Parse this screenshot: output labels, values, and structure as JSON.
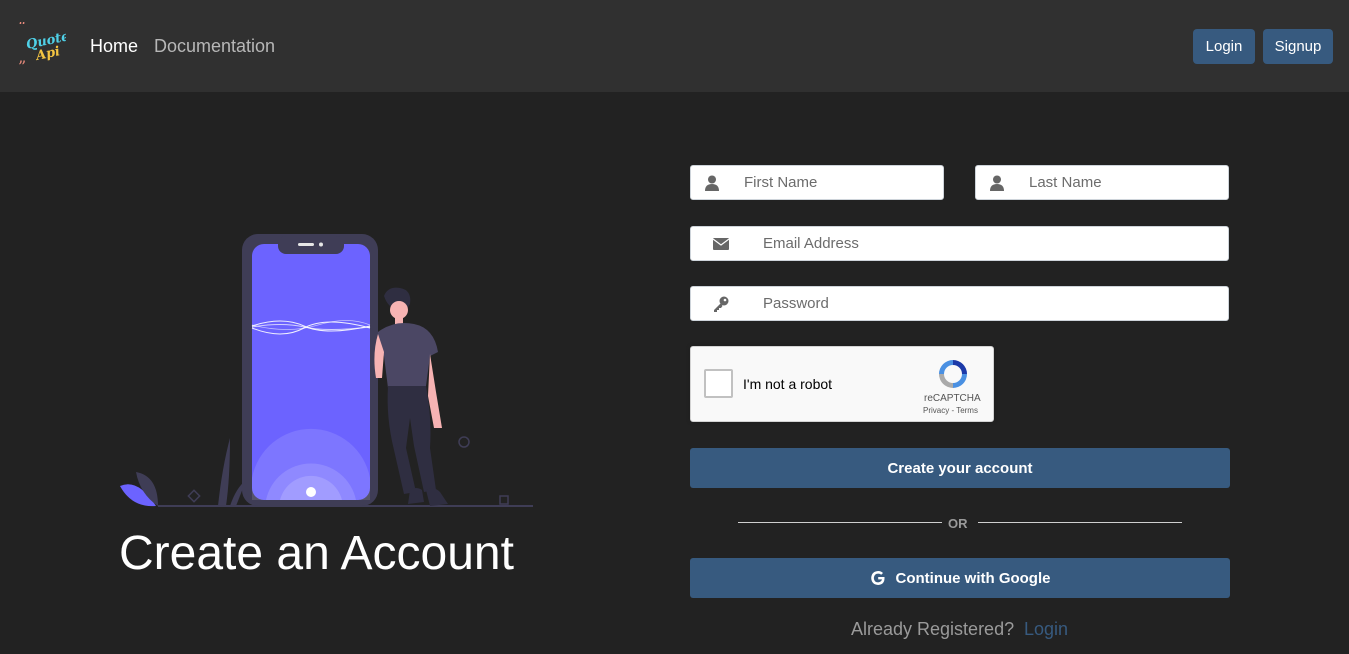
{
  "nav": {
    "logo_text": "Quotes Api",
    "home": "Home",
    "documentation": "Documentation",
    "login": "Login",
    "signup": "Signup"
  },
  "hero": {
    "title": "Create an Account"
  },
  "form": {
    "first_name_placeholder": "First Name",
    "last_name_placeholder": "Last Name",
    "email_placeholder": "Email Address",
    "password_placeholder": "Password",
    "recaptcha": {
      "label": "I'm not a robot",
      "brand": "reCAPTCHA",
      "links": "Privacy - Terms",
      "checked": false
    },
    "create_button": "Create your account",
    "or_text": "OR",
    "google_button": "Continue with Google",
    "already_text": "Already Registered?",
    "login_link": "Login"
  },
  "colors": {
    "background": "#222222",
    "navbar": "#303030",
    "primary": "#375a7f",
    "illustration_accent": "#6c63ff"
  },
  "icons": {
    "first_name": "user-icon",
    "last_name": "user-icon",
    "email": "envelope-icon",
    "password": "key-icon",
    "google": "google-icon"
  }
}
